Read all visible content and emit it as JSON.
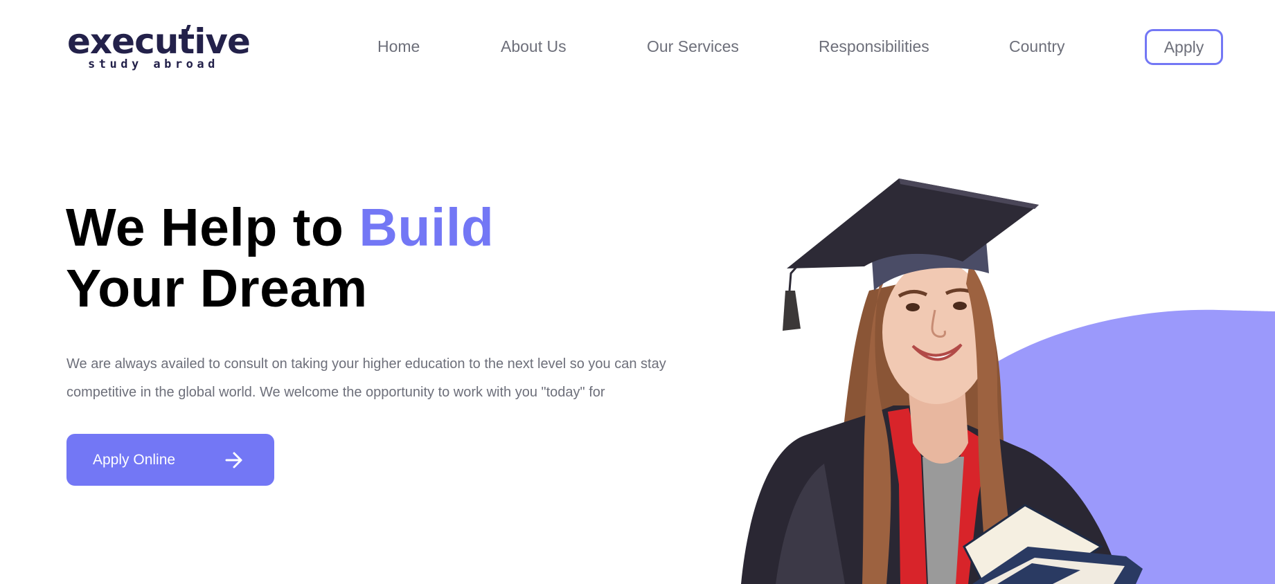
{
  "brand": {
    "name": "executive",
    "tagline": "study abroad",
    "color": "#23214a"
  },
  "nav": {
    "items": [
      {
        "label": "Home"
      },
      {
        "label": "About Us"
      },
      {
        "label": "Our Services"
      },
      {
        "label": "Responsibilities"
      },
      {
        "label": "Country"
      }
    ],
    "apply_label": "Apply"
  },
  "hero": {
    "title_part1": "We Help to ",
    "title_accent": "Build",
    "title_part2": "Your Dream",
    "description": "We are always availed to consult on taking your higher education to the next level so you can stay competitive in the global world. We welcome the opportunity to work with you \"today\" for",
    "cta_label": "Apply Online",
    "cta_icon": "arrow-right-icon",
    "image": "graduate-student-with-books"
  },
  "colors": {
    "accent": "#7377f5",
    "blob": "#9b99fb",
    "text_muted": "#6d6f7a",
    "heading": "#000000"
  }
}
